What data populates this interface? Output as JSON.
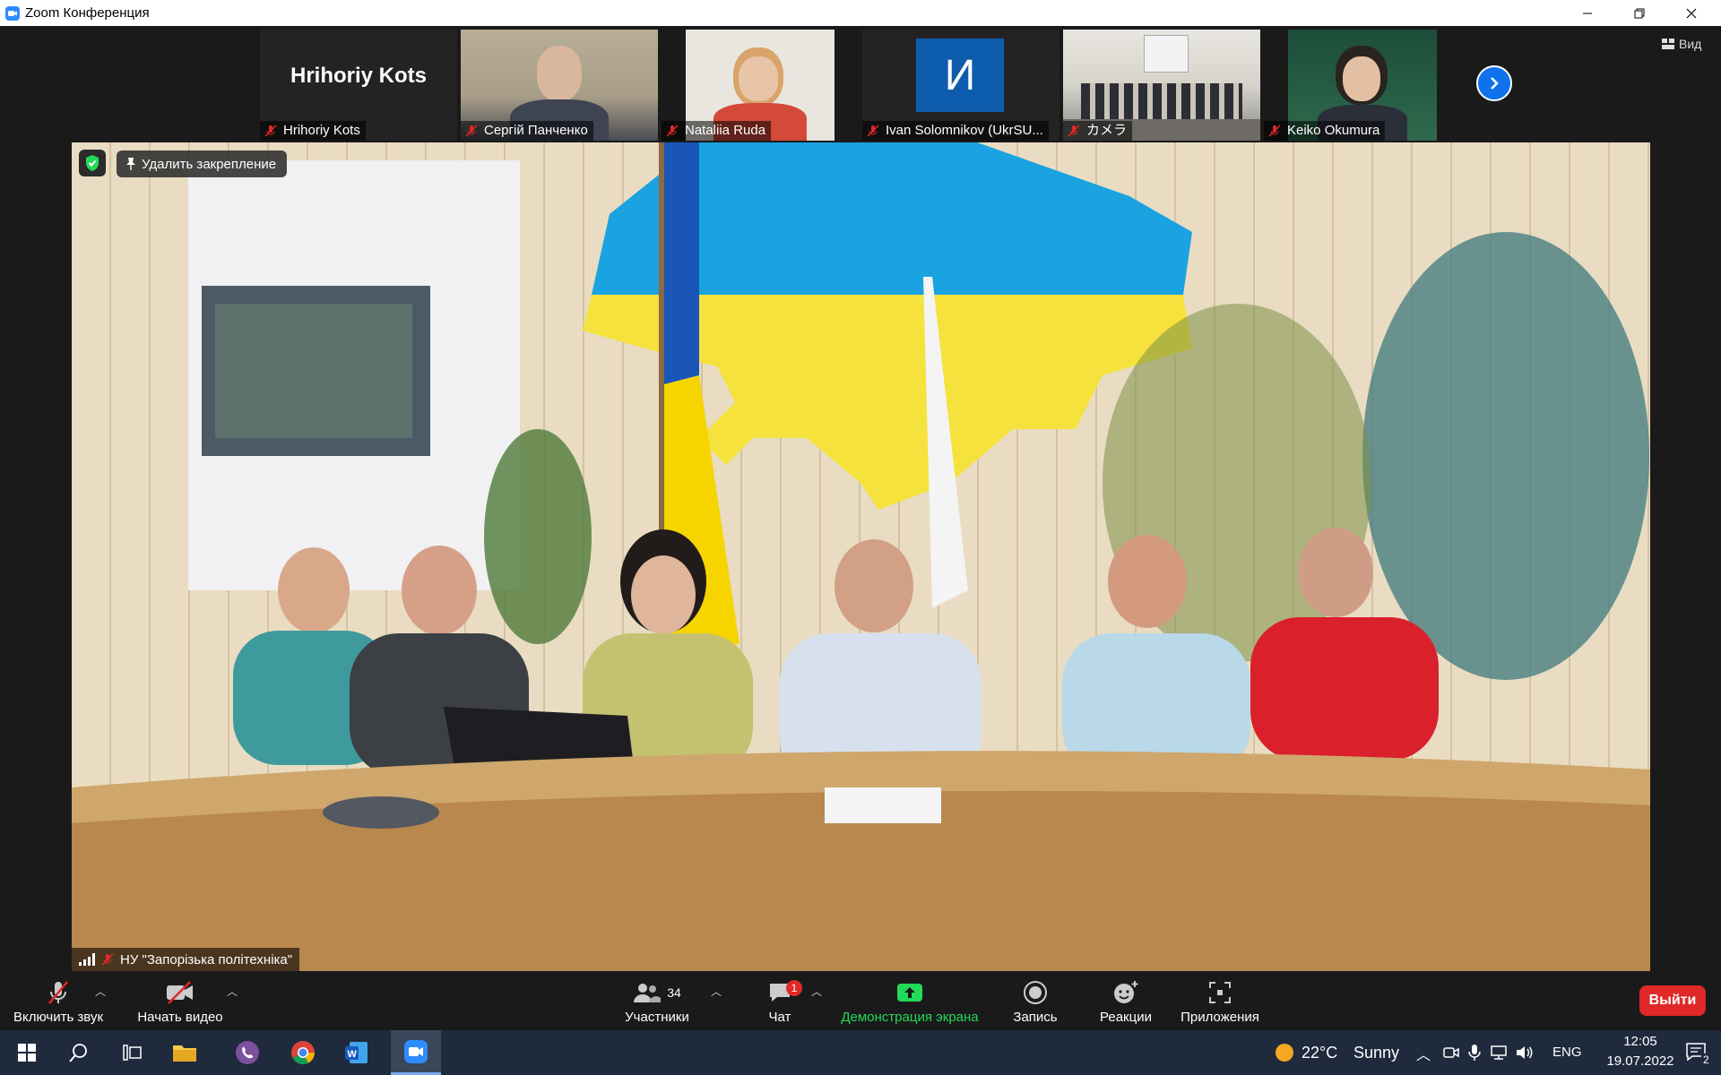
{
  "window": {
    "title": "Zoom Конференция"
  },
  "view": {
    "label": "Вид"
  },
  "participants_strip": [
    {
      "name": "Hrihoriy Kots",
      "big_name": "Hrihoriy Kots"
    },
    {
      "name": "Сергій Панченко"
    },
    {
      "name": "Nataliia Ruda"
    },
    {
      "name": "Ivan Solomnikov (UkrSU...",
      "avatar_letter": "И"
    },
    {
      "name": "カメラ"
    },
    {
      "name": "Keiko Okumura"
    }
  ],
  "main_video": {
    "unpin_label": "Удалить закрепление",
    "speaker_label": "НУ \"Запорізька політехніка\""
  },
  "toolbar": {
    "unmute": "Включить звук",
    "start_video": "Начать видео",
    "participants": "Участники",
    "participants_count": "34",
    "chat": "Чат",
    "chat_badge": "1",
    "share": "Демонстрация экрана",
    "record": "Запись",
    "reactions": "Реакции",
    "apps": "Приложения",
    "leave": "Выйти"
  },
  "taskbar": {
    "weather_temp": "22°C",
    "weather_text": "Sunny",
    "language": "ENG",
    "time": "12:05",
    "date": "19.07.2022",
    "notifications": "2"
  },
  "colors": {
    "zoom_blue": "#2d8cff",
    "leave_red": "#e02828",
    "share_green": "#23d959"
  }
}
